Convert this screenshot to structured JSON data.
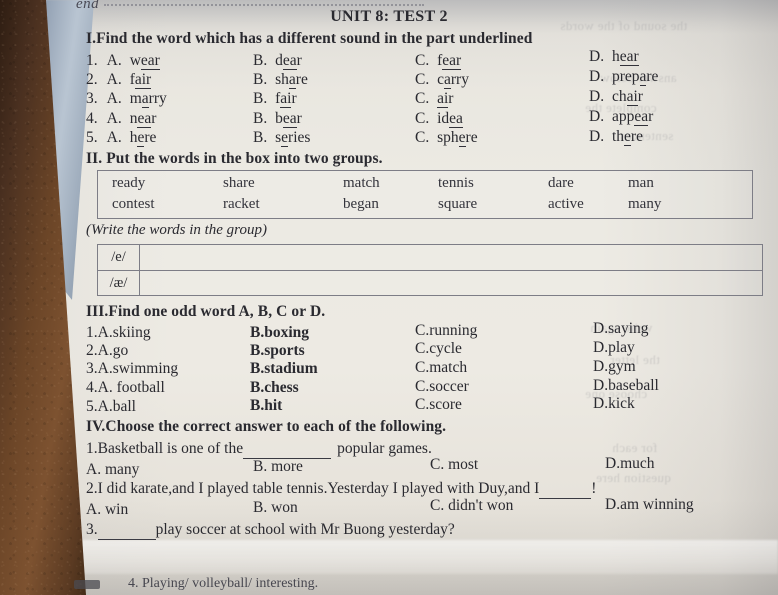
{
  "page": {
    "cut_off_top_text": "end",
    "cut_off_bottom_text": "4. Playing/ volleyball/ interesting.",
    "title": "UNIT 8: TEST 2"
  },
  "section_1": {
    "heading": "I.Find the word which has a different sound in the part underlined",
    "questions": [
      {
        "number": "1.",
        "options": [
          {
            "letter": "A.",
            "pre": "w",
            "underlined": "ear",
            "post": ""
          },
          {
            "letter": "B.",
            "pre": "d",
            "underlined": "ea",
            "post": "r"
          },
          {
            "letter": "C.",
            "pre": "f",
            "underlined": "ear",
            "post": ""
          },
          {
            "letter": "D.",
            "pre": "h",
            "underlined": "ear",
            "post": ""
          }
        ]
      },
      {
        "number": "2.",
        "options": [
          {
            "letter": "A.",
            "pre": "f",
            "underlined": "air",
            "post": ""
          },
          {
            "letter": "B.",
            "pre": "sh",
            "underlined": "a",
            "post": "re"
          },
          {
            "letter": "C.",
            "pre": "c",
            "underlined": "a",
            "post": "rry"
          },
          {
            "letter": "D.",
            "pre": "prep",
            "underlined": "a",
            "post": "re"
          }
        ]
      },
      {
        "number": "3.",
        "options": [
          {
            "letter": "A.",
            "pre": "m",
            "underlined": "a",
            "post": "rry"
          },
          {
            "letter": "B.",
            "pre": "f",
            "underlined": "ai",
            "post": "r"
          },
          {
            "letter": "C.",
            "pre": "",
            "underlined": "ai",
            "post": "r"
          },
          {
            "letter": "D.",
            "pre": "ch",
            "underlined": "ai",
            "post": "r"
          }
        ]
      },
      {
        "number": "4.",
        "options": [
          {
            "letter": "A.",
            "pre": "n",
            "underlined": "ea",
            "post": "r"
          },
          {
            "letter": "B.",
            "pre": "b",
            "underlined": "ea",
            "post": "r"
          },
          {
            "letter": "C.",
            "pre": "id",
            "underlined": "ea",
            "post": ""
          },
          {
            "letter": "D.",
            "pre": "app",
            "underlined": "ea",
            "post": "r"
          }
        ]
      },
      {
        "number": "5.",
        "options": [
          {
            "letter": "A.",
            "pre": "h",
            "underlined": "e",
            "post": "re"
          },
          {
            "letter": "B.",
            "pre": "s",
            "underlined": "e",
            "post": "ries"
          },
          {
            "letter": "C.",
            "pre": "sph",
            "underlined": "e",
            "post": "re"
          },
          {
            "letter": "D.",
            "pre": "th",
            "underlined": "e",
            "post": "re"
          }
        ]
      }
    ]
  },
  "section_2": {
    "heading": "II. Put the words in the box into two groups.",
    "word_box_row1": [
      "ready",
      "share",
      "match",
      "tennis",
      "dare",
      "man"
    ],
    "word_box_row2": [
      "contest",
      "racket",
      "began",
      "square",
      "active",
      "many"
    ],
    "instruction": "(Write the words in the group)",
    "group_rows": [
      {
        "label": "/e/",
        "answer": ""
      },
      {
        "label": "/æ/",
        "answer": ""
      }
    ]
  },
  "section_3": {
    "heading": "III.Find one odd word A, B, C or D.",
    "questions": [
      {
        "number": "1.",
        "a": "A.skiing",
        "b": "B.boxing",
        "c": "C.running",
        "d": "D.saying"
      },
      {
        "number": "2.",
        "a": "A.go",
        "b": "B.sports",
        "c": "C.cycle",
        "d": "D.play"
      },
      {
        "number": "3.",
        "a": "A.swimming",
        "b": "B.stadium",
        "c": "C.match",
        "d": "D.gym"
      },
      {
        "number": "4.",
        "a": "A. football",
        "b": "B.chess",
        "c": "C.soccer",
        "d": "D.baseball"
      },
      {
        "number": "5.",
        "a": "A.ball",
        "b": "B.hit",
        "c": "C.score",
        "d": "D.kick"
      }
    ]
  },
  "section_4": {
    "heading": "IV.Choose the correct answer to each of the following.",
    "questions": [
      {
        "number": "1.",
        "stem_before": "Basketball is one of the",
        "stem_after": "popular games.",
        "options": [
          "A. many",
          "B. more",
          "C. most",
          "D.much"
        ]
      },
      {
        "number": "2.",
        "stem_before": "I did karate,and I played table tennis.Yesterday I played with Duy,and I",
        "stem_after": "!",
        "options": [
          "A. win",
          "B. won",
          "C. didn't won",
          "D.am winning"
        ]
      },
      {
        "number": "3.",
        "stem_before": "",
        "stem_after": "play soccer at school with Mr Buong yesterday?",
        "options": []
      }
    ]
  }
}
